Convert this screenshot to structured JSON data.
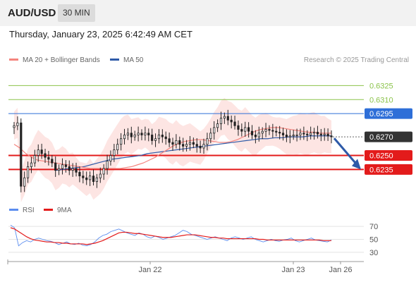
{
  "header": {
    "symbol": "AUD/USD",
    "interval": "30 MIN",
    "datetime": "Thursday, January 23, 2025 6:42:49 AM CET"
  },
  "legend": {
    "items": [
      {
        "label": "MA 20 + Bollinger Bands",
        "color": "#f4847e"
      },
      {
        "label": "MA 50",
        "color": "#2e5aa8"
      }
    ],
    "copyright": "Research © 2025 Trading Central"
  },
  "indicator_legend": {
    "items": [
      {
        "label": "RSI",
        "color": "#5b8def"
      },
      {
        "label": "9MA",
        "color": "#e31b1b"
      }
    ]
  },
  "colors": {
    "up_candle": "#222222",
    "down_candle": "#222222",
    "resistance": "#8bc34a",
    "pivot": "#2e6fd8",
    "support": "#e31b1b",
    "current": "#333333",
    "bands_fill": "#fde0de",
    "ma20": "#f4847e",
    "ma50": "#2e5aa8",
    "arrow": "#2e5aa8"
  },
  "chart_data": [
    {
      "type": "candlestick",
      "title": "AUD/USD",
      "ylim": [
        0.6205,
        0.6345
      ],
      "x_tick_labels": [
        "Jan 22",
        "Jan 23",
        "Jan 26"
      ],
      "levels": [
        {
          "value": 0.6325,
          "label": "0.6325",
          "kind": "resistance"
        },
        {
          "value": 0.631,
          "label": "0.6310",
          "kind": "resistance"
        },
        {
          "value": 0.6295,
          "label": "0.6295",
          "kind": "pivot"
        },
        {
          "value": 0.627,
          "label": "0.6270",
          "kind": "current"
        },
        {
          "value": 0.625,
          "label": "0.6250",
          "kind": "support"
        },
        {
          "value": 0.6235,
          "label": "0.6235",
          "kind": "support"
        }
      ],
      "close": [
        0.6282,
        0.6285,
        0.6217,
        0.6226,
        0.6238,
        0.6242,
        0.625,
        0.6256,
        0.6252,
        0.6248,
        0.6246,
        0.6242,
        0.6234,
        0.6236,
        0.624,
        0.6238,
        0.6234,
        0.6236,
        0.6232,
        0.6228,
        0.6226,
        0.6224,
        0.6228,
        0.6222,
        0.6226,
        0.623,
        0.6236,
        0.6244,
        0.625,
        0.6256,
        0.6262,
        0.6268,
        0.6272,
        0.6274,
        0.627,
        0.6272,
        0.6274,
        0.6272,
        0.6274,
        0.6272,
        0.6266,
        0.6268,
        0.6272,
        0.627,
        0.6268,
        0.6264,
        0.6262,
        0.6266,
        0.6262,
        0.626,
        0.6262,
        0.6264,
        0.6262,
        0.626,
        0.6258,
        0.6262,
        0.6268,
        0.6274,
        0.628,
        0.6284,
        0.629,
        0.6292,
        0.6288,
        0.6286,
        0.6282,
        0.6278,
        0.6276,
        0.628,
        0.6276,
        0.6272,
        0.627,
        0.6274,
        0.6276,
        0.6278,
        0.6277,
        0.6276,
        0.6275,
        0.6274,
        0.6272,
        0.627,
        0.6271,
        0.6272,
        0.6272,
        0.6274,
        0.6273,
        0.6272,
        0.6274,
        0.6275,
        0.6273,
        0.6272,
        0.6273,
        0.6271,
        0.627
      ],
      "ma20": [
        0.6262,
        0.6258,
        0.6252,
        0.6248,
        0.6245,
        0.6244,
        0.6243,
        0.6242,
        0.6241,
        0.624,
        0.6239,
        0.6238,
        0.6237,
        0.6236,
        0.6236,
        0.6236,
        0.6236,
        0.6236,
        0.6236,
        0.6237,
        0.6238,
        0.624,
        0.6242,
        0.6245,
        0.6248,
        0.6252,
        0.6256,
        0.626,
        0.6263,
        0.6265,
        0.6266,
        0.6267,
        0.6267,
        0.6266,
        0.6265,
        0.6264,
        0.6264,
        0.6265,
        0.6267,
        0.627,
        0.6273,
        0.6276,
        0.6278,
        0.6279,
        0.628,
        0.628,
        0.6279,
        0.6278,
        0.6277,
        0.6276,
        0.6275,
        0.6275,
        0.6274,
        0.6274,
        0.6274
      ],
      "ma50": [
        0.6234,
        0.6235,
        0.6236,
        0.6237,
        0.6238,
        0.624,
        0.6242,
        0.6244,
        0.6246,
        0.6247,
        0.6248,
        0.6249,
        0.625,
        0.6252,
        0.6253,
        0.6254,
        0.6255,
        0.6256,
        0.6257,
        0.6258,
        0.6259,
        0.626,
        0.6261,
        0.6262,
        0.6263,
        0.6264,
        0.6265,
        0.6266,
        0.6267,
        0.6268,
        0.6268,
        0.6269,
        0.6269,
        0.627,
        0.627,
        0.627,
        0.6271,
        0.6271,
        0.6271,
        0.6271
      ],
      "forecast_arrow": {
        "from": 0.627,
        "to": 0.6235
      }
    },
    {
      "type": "line",
      "title": "RSI",
      "ylim": [
        20,
        80
      ],
      "y_ticks": [
        70,
        50,
        30
      ],
      "series": [
        {
          "name": "RSI",
          "values": [
            72,
            68,
            40,
            45,
            48,
            46,
            50,
            52,
            50,
            48,
            47,
            45,
            42,
            44,
            46,
            43,
            42,
            44,
            41,
            40,
            42,
            46,
            52,
            56,
            58,
            62,
            64,
            66,
            63,
            60,
            58,
            56,
            60,
            58,
            54,
            52,
            55,
            53,
            50,
            52,
            54,
            56,
            60,
            64,
            62,
            58,
            56,
            54,
            52,
            50,
            52,
            54,
            52,
            50,
            48,
            52,
            54,
            52,
            50,
            52,
            54,
            50,
            48,
            46,
            48,
            50,
            48,
            47,
            49,
            50,
            52,
            48,
            46,
            48,
            50,
            52,
            49,
            48,
            47,
            46,
            49
          ]
        },
        {
          "name": "9MA",
          "values": [
            68,
            66,
            62,
            58,
            54,
            51,
            49,
            48,
            47,
            46,
            46,
            45,
            45,
            44,
            44,
            43,
            43,
            43,
            43,
            42,
            43,
            44,
            46,
            48,
            51,
            54,
            57,
            60,
            61,
            61,
            60,
            59,
            59,
            58,
            57,
            56,
            55,
            54,
            53,
            53,
            53,
            54,
            55,
            56,
            57,
            57,
            57,
            56,
            55,
            54,
            53,
            53,
            52,
            52,
            51,
            51,
            51,
            51,
            51,
            51,
            51,
            51,
            50,
            50,
            49,
            49,
            49,
            49,
            49,
            49,
            49,
            49,
            49,
            49,
            49,
            49,
            49,
            49,
            48,
            48,
            48
          ]
        }
      ]
    }
  ]
}
